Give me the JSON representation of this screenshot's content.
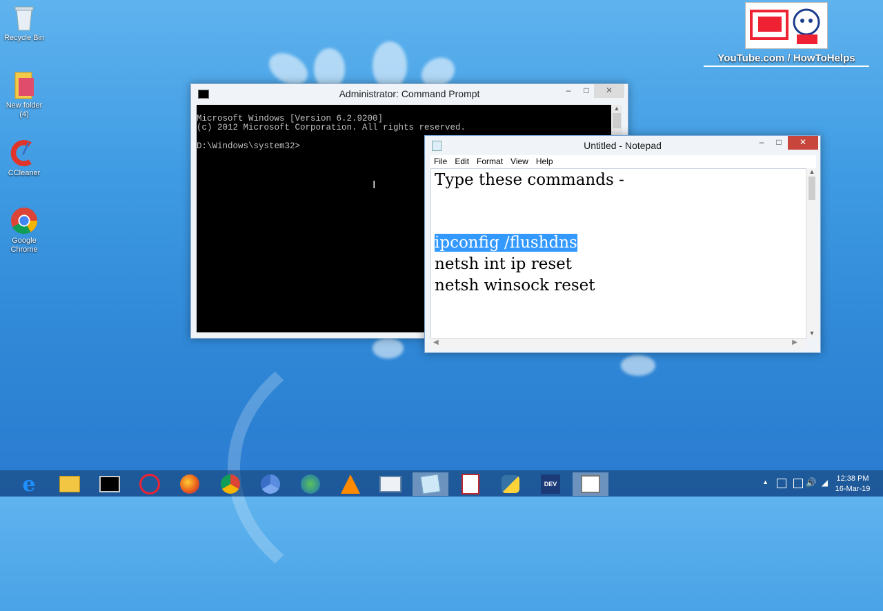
{
  "desktop": {
    "icons": [
      {
        "label": "Recycle Bin",
        "icon": "recycle-bin-icon"
      },
      {
        "label": "New folder\n(4)",
        "icon": "folder-icon"
      },
      {
        "label": "CCleaner",
        "icon": "ccleaner-icon"
      },
      {
        "label": "Google\nChrome",
        "icon": "chrome-icon"
      }
    ],
    "watermark": "YouTube.com / HowToHelps"
  },
  "cmd": {
    "title": "Administrator: Command Prompt",
    "line1": "Microsoft Windows [Version 6.2.9200]",
    "line2": "(c) 2012 Microsoft Corporation. All rights reserved.",
    "line3": "",
    "line4": "D:\\Windows\\system32>"
  },
  "notepad": {
    "title": "Untitled - Notepad",
    "menu": [
      "File",
      "Edit",
      "Format",
      "View",
      "Help"
    ],
    "lines": {
      "heading": "Type these commands -",
      "cmd1": "ipconfig /flushdns",
      "cmd2": "netsh int ip reset",
      "cmd3": "netsh winsock reset"
    }
  },
  "taskbar": {
    "items": [
      "internet-explorer-icon",
      "file-explorer-icon",
      "command-prompt-icon",
      "snipping-tool-icon",
      "firefox-icon",
      "chrome-icon",
      "chromium-icon",
      "globe-download-icon",
      "vlc-icon",
      "keyboard-icon",
      "notepad-icon",
      "acrobat-icon",
      "python-icon",
      "dev-cpp-icon",
      "clipboard-icon"
    ],
    "time": "12:38 PM",
    "date": "16-Mar-19"
  }
}
